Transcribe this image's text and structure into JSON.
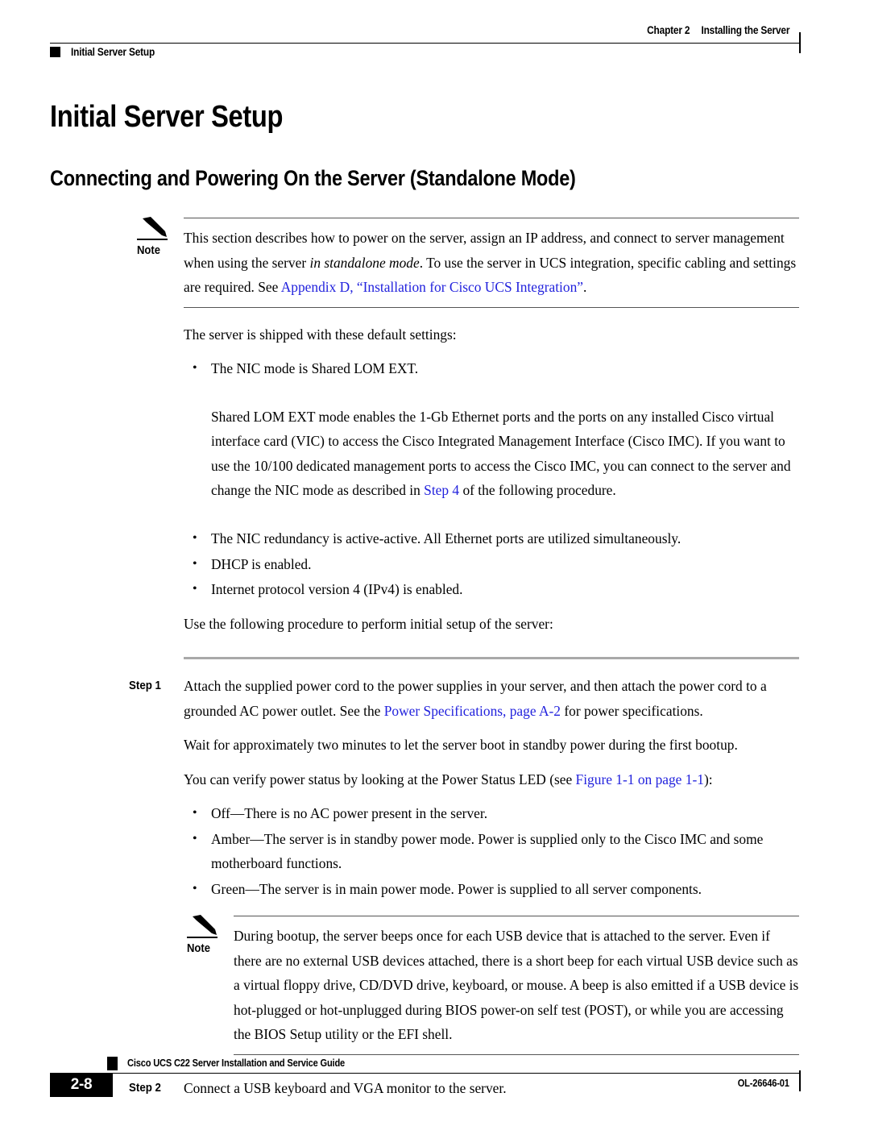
{
  "header": {
    "chapter_label": "Chapter 2",
    "chapter_title": "Installing the Server",
    "section_title": "Initial Server Setup"
  },
  "headings": {
    "h1": "Initial Server Setup",
    "h2": "Connecting and Powering On the Server (Standalone Mode)"
  },
  "note1": {
    "label": "Note",
    "text_part1": "This section describes how to power on the server, assign an IP address, and connect to server management when using the server ",
    "text_italic": "in standalone mode",
    "text_part2": ". To use the server in UCS integration, specific cabling and settings are required. See ",
    "link": "Appendix D, “Installation for Cisco UCS Integration”",
    "text_part3": "."
  },
  "intro": {
    "defaults_lead": "The server is shipped with these default settings:",
    "bullet_nic_mode": "The NIC mode is Shared LOM EXT.",
    "nic_mode_para_part1": "Shared LOM EXT mode enables the 1-Gb Ethernet ports and the ports on any installed Cisco virtual interface card (VIC) to access the Cisco Integrated Management Interface (Cisco IMC). If you want to use the 10/100 dedicated management ports to access the Cisco IMC, you can connect to the server and change the NIC mode as described in ",
    "nic_mode_link": "Step 4",
    "nic_mode_para_part2": " of the following procedure.",
    "bullet_redundancy": "The NIC redundancy is active-active. All Ethernet ports are utilized simultaneously.",
    "bullet_dhcp": "DHCP is enabled.",
    "bullet_ipv4": "Internet protocol version 4 (IPv4) is enabled.",
    "procedure_lead": "Use the following procedure to perform initial setup of the server:"
  },
  "step1": {
    "label": "Step 1",
    "text_part1": "Attach the supplied power cord to the power supplies in your server, and then attach the power cord to a grounded AC power outlet. See the ",
    "link": "Power Specifications, page A-2",
    "text_part2": " for power specifications.",
    "wait_para": "Wait for approximately two minutes to let the server boot in standby power during the first bootup.",
    "verify_part1": "You can verify power status by looking at the Power Status LED (see ",
    "verify_link": "Figure 1-1 on page 1-1",
    "verify_part2": "):",
    "led_off": "Off—There is no AC power present in the server.",
    "led_amber": "Amber—The server is in standby power mode. Power is supplied only to the Cisco IMC and some motherboard functions.",
    "led_green": "Green—The server is in main power mode. Power is supplied to all server components."
  },
  "note2": {
    "label": "Note",
    "text": "During bootup, the server beeps once for each USB device that is attached to the server. Even if there are no external USB devices attached, there is a short beep for each virtual USB device such as a virtual floppy drive, CD/DVD drive, keyboard, or mouse. A beep is also emitted if a USB device is hot-plugged or hot-unplugged during BIOS power-on self test (POST), or while you are accessing the BIOS Setup utility or the EFI shell."
  },
  "step2": {
    "label": "Step 2",
    "text": "Connect a USB keyboard and VGA monitor to the server."
  },
  "footer": {
    "page_number": "2-8",
    "guide_title": "Cisco UCS C22 Server Installation and Service Guide",
    "doc_id": "OL-26646-01"
  },
  "colors": {
    "link": "#2222dd",
    "rule_gray": "#a9a9a9",
    "text": "#000000"
  }
}
